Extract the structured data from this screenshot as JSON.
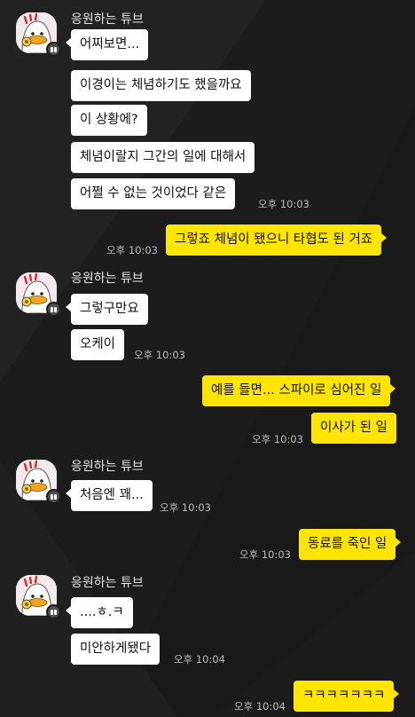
{
  "colors": {
    "background": "#1c1c1c",
    "incoming_bubble": "#ffffff",
    "outgoing_bubble": "#fee500",
    "sender_name": "#e6e6e6",
    "timestamp": "#bdbdbd"
  },
  "chat": {
    "sender_name": "응원하는 튜브",
    "avatar_icon": "tube-character-icon",
    "g1": {
      "m1": "어찌보면...",
      "m2": "이경이는 체념하기도 했을까요",
      "m3": "이 상황에?",
      "m4": "체념이랄지 그간의 일에 대해서",
      "m5": "어쩔 수 없는 것이었다 같은",
      "time": "오후 10:03"
    },
    "o1": {
      "m1": "그렇죠 체념이 됐으니 타협도 된 거죠",
      "time": "오후 10:03"
    },
    "g2": {
      "m1": "그렇구만요",
      "m2": "오케이",
      "time": "오후 10:03"
    },
    "o2": {
      "m1": "예를 들면... 스파이로 심어진 일",
      "m2": "이사가 된 일",
      "time": "오후 10:03"
    },
    "g3": {
      "m1": "처음엔 꽤...",
      "time": "오후 10:03"
    },
    "o3": {
      "m1": "동료를 죽인 일",
      "time": "오후 10:03"
    },
    "g4": {
      "m1": "....ㅎ.ㅋ",
      "m2": "미안하게됐다",
      "time": "오후 10:04"
    },
    "o4": {
      "m1": "ㅋㅋㅋㅋㅋㅋㅋ",
      "time": "오후 10:04"
    }
  }
}
